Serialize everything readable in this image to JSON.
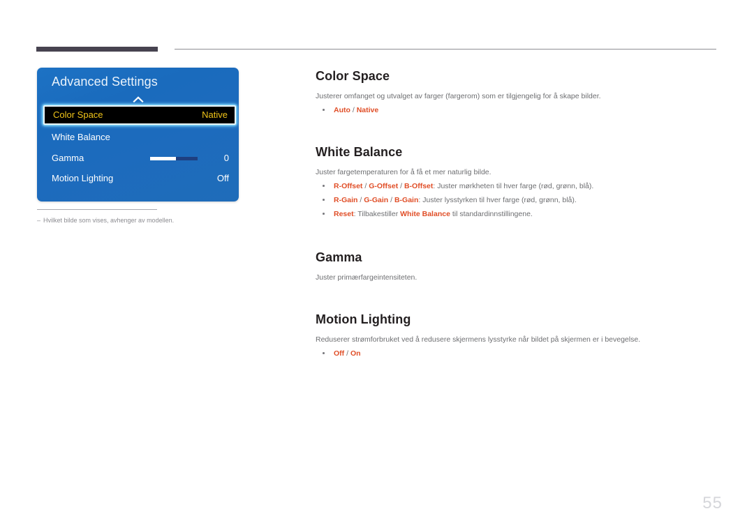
{
  "page": {
    "number": "55",
    "language": "no"
  },
  "osd": {
    "title": "Advanced Settings",
    "scroll_up_icon": "chevron-up-icon",
    "items": [
      {
        "label": "Color Space",
        "value": "Native",
        "selected": true,
        "type": "option"
      },
      {
        "label": "White Balance",
        "value": "",
        "selected": false,
        "type": "submenu"
      },
      {
        "label": "Gamma",
        "value": "0",
        "selected": false,
        "type": "slider",
        "slider_percent": 54
      },
      {
        "label": "Motion Lighting",
        "value": "Off",
        "selected": false,
        "type": "option"
      }
    ],
    "colors": {
      "panel_blue": "#1d6bbd",
      "selected_background": "#000000",
      "selected_text": "#f0c419",
      "selected_glow": "#78d7ff",
      "slider_fill": "#ffffff",
      "slider_track": "#1e3f80"
    }
  },
  "footnote": {
    "dash": "–",
    "text": "Hvilket bilde som vises, avhenger av modellen."
  },
  "content": {
    "sections": [
      {
        "id": "color-space",
        "heading": "Color Space",
        "description": "Justerer omfanget og utvalget av farger (fargerom) som er tilgjengelig for å skape bilder.",
        "bullets": [
          {
            "parts": [
              {
                "text": "Auto",
                "style": "highlight"
              },
              {
                "text": " / ",
                "style": "separator"
              },
              {
                "text": "Native",
                "style": "highlight"
              }
            ]
          }
        ]
      },
      {
        "id": "white-balance",
        "heading": "White Balance",
        "description": "Juster fargetemperaturen for å få et mer naturlig bilde.",
        "bullets": [
          {
            "parts": [
              {
                "text": "R-Offset",
                "style": "highlight"
              },
              {
                "text": " / ",
                "style": "separator"
              },
              {
                "text": "G-Offset",
                "style": "highlight"
              },
              {
                "text": " / ",
                "style": "separator"
              },
              {
                "text": "B-Offset",
                "style": "highlight"
              },
              {
                "text": ": Juster mørkheten til hver farge (rød, grønn, blå).",
                "style": "plain"
              }
            ]
          },
          {
            "parts": [
              {
                "text": "R-Gain",
                "style": "highlight"
              },
              {
                "text": " / ",
                "style": "separator"
              },
              {
                "text": "G-Gain",
                "style": "highlight"
              },
              {
                "text": " / ",
                "style": "separator"
              },
              {
                "text": "B-Gain",
                "style": "highlight"
              },
              {
                "text": ": Juster lysstyrken til hver farge (rød, grønn, blå).",
                "style": "plain"
              }
            ]
          },
          {
            "parts": [
              {
                "text": "Reset",
                "style": "highlight"
              },
              {
                "text": ": Tilbakestiller ",
                "style": "plain"
              },
              {
                "text": "White Balance",
                "style": "highlight"
              },
              {
                "text": " til standardinnstillingene.",
                "style": "plain"
              }
            ]
          }
        ]
      },
      {
        "id": "gamma",
        "heading": "Gamma",
        "description": "Juster primærfargeintensiteten.",
        "bullets": []
      },
      {
        "id": "motion-lighting",
        "heading": "Motion Lighting",
        "description": "Reduserer strømforbruket ved å redusere skjermens lysstyrke når bildet på skjermen er i bevegelse.",
        "bullets": [
          {
            "parts": [
              {
                "text": "Off",
                "style": "highlight"
              },
              {
                "text": " / ",
                "style": "separator"
              },
              {
                "text": "On",
                "style": "highlight"
              }
            ]
          }
        ]
      }
    ]
  },
  "theme": {
    "heading_color": "#231f20",
    "body_text_color": "#6d6e71",
    "accent_color": "#e04e27",
    "rule_dark": "#474350",
    "rule_light": "#8d8d93",
    "page_number_color": "#d5d6da"
  }
}
